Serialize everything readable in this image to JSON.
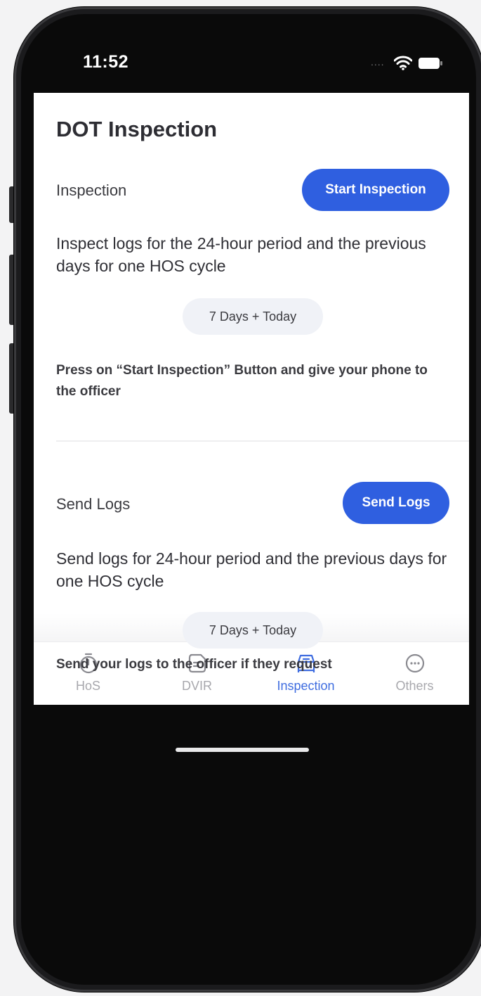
{
  "status_bar": {
    "time": "11:52",
    "signal_dots": "....",
    "wifi_icon": "wifi-icon",
    "battery_icon": "battery-icon"
  },
  "page": {
    "title": "DOT Inspection"
  },
  "inspection": {
    "label": "Inspection",
    "button": "Start Inspection",
    "description": "Inspect logs for the 24-hour period and the previous days for one HOS cycle",
    "chip": "7 Days + Today",
    "instruction": "Press on “Start Inspection” Button and give your phone to the officer"
  },
  "send_logs": {
    "label": "Send Logs",
    "button": "Send Logs",
    "description": "Send logs for 24-hour period and the previous days for one HOS cycle",
    "chip": "7 Days + Today",
    "instruction": "Send your logs to the officer if they request"
  },
  "tabs": [
    {
      "label": "HoS",
      "icon": "stopwatch-icon",
      "active": false
    },
    {
      "label": "DVIR",
      "icon": "document-icon",
      "active": false
    },
    {
      "label": "Inspection",
      "icon": "car-icon",
      "active": true
    },
    {
      "label": "Others",
      "icon": "more-icon",
      "active": false
    }
  ],
  "colors": {
    "accent": "#2f5fe0",
    "active_tab": "#3f6de0",
    "inactive_tab": "#a8a8ad",
    "chip_bg": "#f0f2f7"
  }
}
